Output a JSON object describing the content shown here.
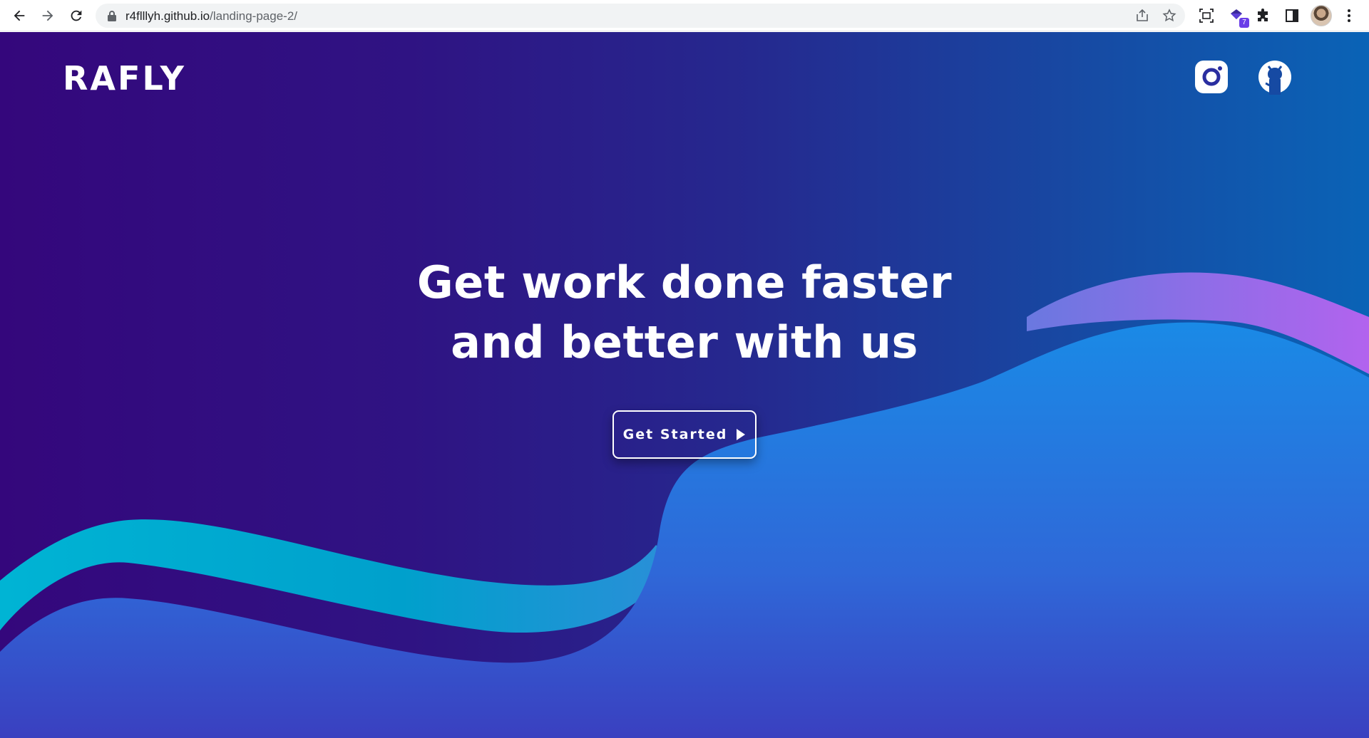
{
  "browser": {
    "url_host": "r4flllyh.github.io",
    "url_path": "/landing-page-2/",
    "extension_badge": "7",
    "icons": {
      "back": "arrow-left-icon",
      "forward": "arrow-right-icon",
      "reload": "reload-icon",
      "lock": "lock-icon",
      "share": "share-icon",
      "bookmark": "star-icon",
      "screenshot": "screenshot-icon",
      "extension": "extension-gem-icon",
      "extensions_menu": "puzzle-icon",
      "side_panel": "side-panel-icon",
      "profile": "avatar",
      "menu": "kebab-menu-icon"
    }
  },
  "page": {
    "logo": "RAFLY",
    "social": {
      "instagram": "instagram-icon",
      "github": "github-icon"
    },
    "hero": {
      "line1": "Get work done faster",
      "line2": "and better with us"
    },
    "cta_label": "Get Started"
  },
  "colors": {
    "bg_left": "#34077c",
    "bg_right": "#0a63b6",
    "wave_teal": "#00a5cc",
    "wave_blue": "#1e88e5",
    "wave_purple": "#b061ee",
    "text": "#ffffff"
  }
}
